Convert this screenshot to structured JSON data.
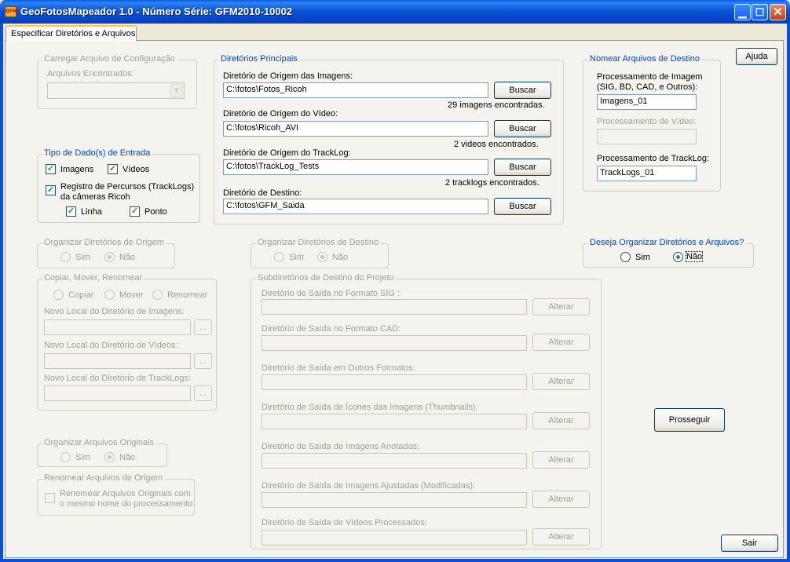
{
  "window": {
    "title": "GeoFotosMapeador 1.0 - Número Série: GFM2010-10002",
    "icon_text": "GFM",
    "minimize": "▁",
    "maximize": "☐",
    "close": "✕"
  },
  "tab": {
    "label": "Especificar Diretórios e Arquivos"
  },
  "help_button": "Ajuda",
  "carregar": {
    "title": "Carregar Arquivo de Configuração",
    "found_label": "Arquivos Encontrados:",
    "combo_arrow": "▼"
  },
  "tipo_dados": {
    "title": "Tipo de Dado(s) de Entrada",
    "imagens": "Imagens",
    "videos": "Vídeos",
    "tracklogs": "Registro de Percursos (TrackLogs)",
    "tracklogs2": "da câmeras Ricoh",
    "linha": "Linha",
    "ponto": "Ponto",
    "check": "✓"
  },
  "org_origem": {
    "title": "Organizar Diretórios de Origem",
    "sim": "Sim",
    "nao": "Não"
  },
  "copiar": {
    "title": "Copiar, Mover, Renomear",
    "copiar": "Copiar",
    "mover": "Mover",
    "renomear": "Renomear",
    "novo_imagens": "Novo Local do Diretório de  Imagens:",
    "novo_videos": "Novo Local do Diretório de Vídeos:",
    "novo_tracklogs": "Novo Local do Diretório de TrackLogs:",
    "browse": "..."
  },
  "org_originais": {
    "title": "Organizar Arquivos Originais",
    "sim": "Sim",
    "nao": "Não"
  },
  "renomear_origem": {
    "title": "Renomear Arquivos de Origem",
    "line1": "Renomear Arquivos Originais com",
    "line2": "o mesmo nome do processamento."
  },
  "principais": {
    "title": "Diretórios Principais",
    "img_label": "Diretório de Origem das Imagens:",
    "img_value": "C:\\fotos\\Fotos_Ricoh",
    "img_count": "29 imagens encontradas.",
    "vid_label": "Diretório de Origem do Vídeo:",
    "vid_value": "C:\\fotos\\Ricoh_AVI",
    "vid_count": "2 videos encontrados.",
    "trk_label": "Diretório de Origem do TrackLog:",
    "trk_value": "C:\\fotos\\TrackLog_Tests",
    "trk_count": "2 tracklogs encontrados.",
    "dst_label": "Diretório de Destino:",
    "dst_value": "C:\\fotos\\GFM_Saida",
    "buscar": "Buscar"
  },
  "org_destino": {
    "title": "Organizar Diretórios de Destino",
    "sim": "Sim",
    "nao": "Não"
  },
  "subdiretorios": {
    "title": "Subdiretórios de Destino do Projeto",
    "sig": "Diretório de Saída no Formato SIG :",
    "cad": "Diretório de Saída no Formato CAD:",
    "outros": "Diretório de Saída em Outros Formatos:",
    "thumbs": "Diretório de Saída de Ícones das Imagens (Thumbnails):",
    "anotadas": "Diretório de Saída de Imagens Anotadas:",
    "ajustadas": "Diretório de Saída de Imagens Ajustadas (Modificadas):",
    "videos": "Diretório de Saída de Vídeos Processados:",
    "alterar": "Alterar"
  },
  "nomear": {
    "title": "Nomear Arquivos de Destino",
    "img_label1": "Processamento de Imagem",
    "img_label2": "(SIG, BD, CAD, e Outros):",
    "img_value": "Imagens_01",
    "vid_label": "Processamento de Vídeo:",
    "vid_value": ".",
    "trk_label": "Processamento de TrackLog:",
    "trk_value": "TrackLogs_01"
  },
  "deseja": {
    "title": "Deseja Organizar Diretórios e Arquivos?",
    "sim": "Sim",
    "nao": "Não"
  },
  "prosseguir": "Prosseguir",
  "sair": "Sair"
}
